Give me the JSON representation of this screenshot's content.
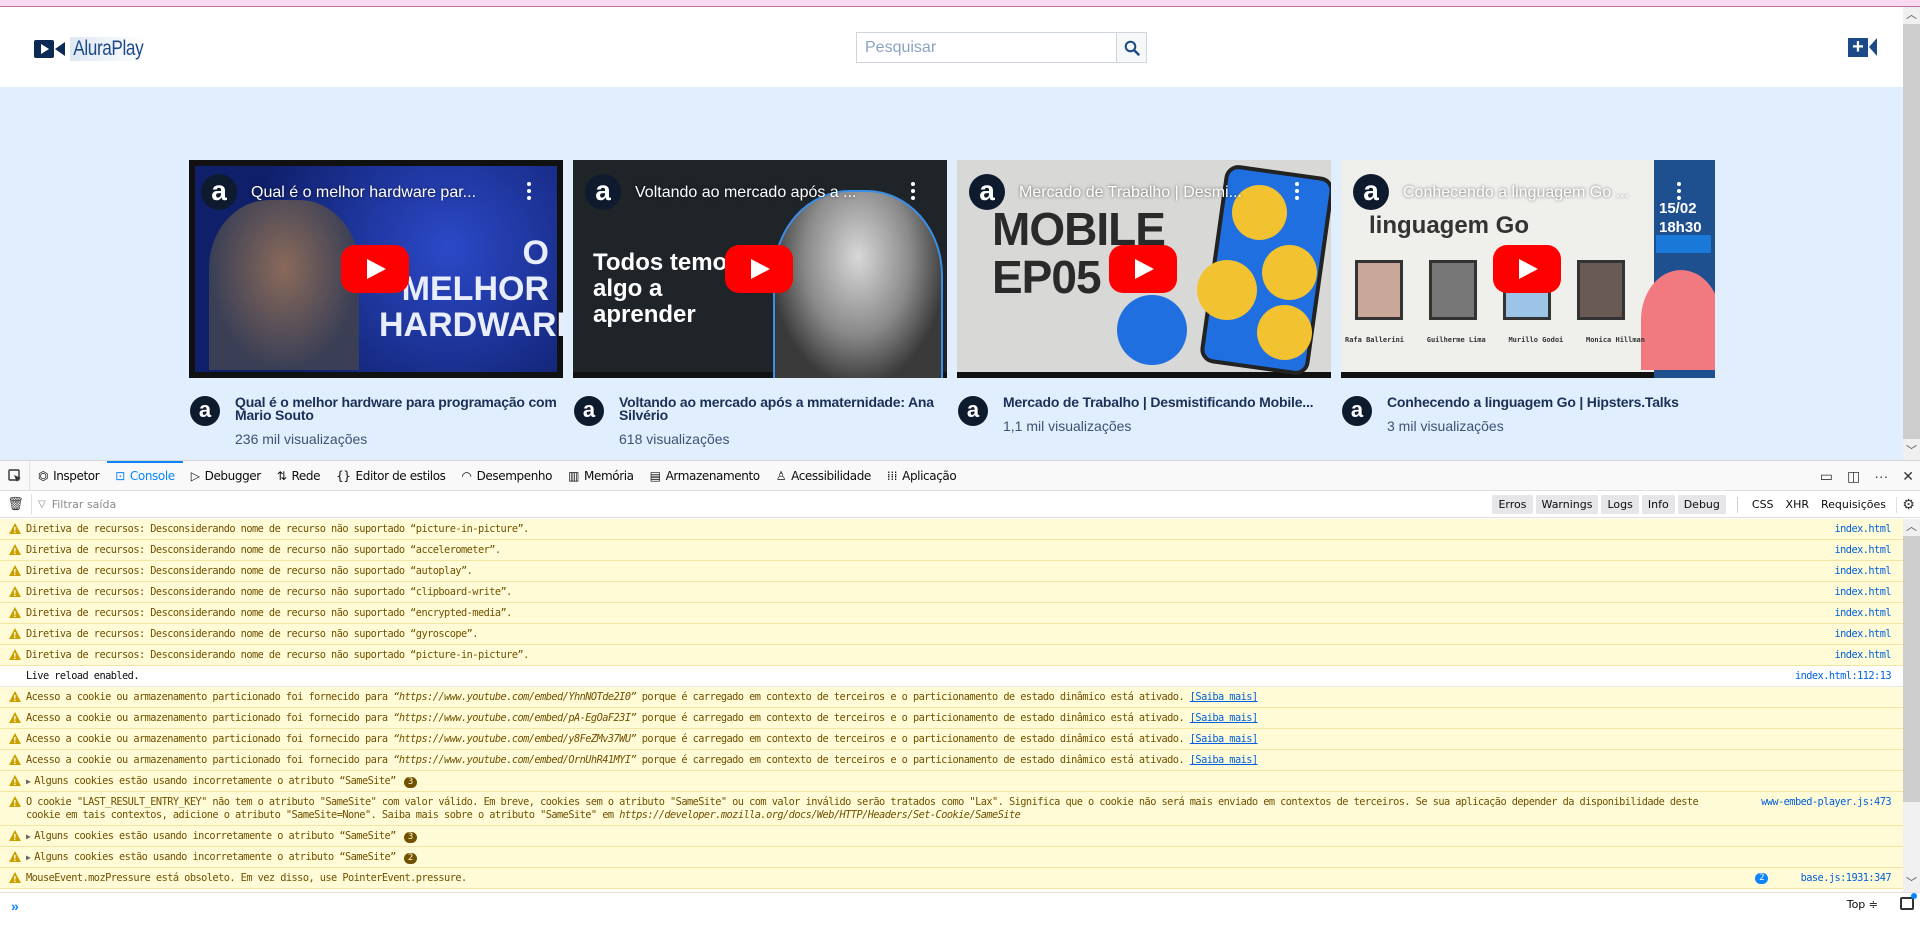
{
  "site": {
    "logo_text": "AluraPlay",
    "search_placeholder": "Pesquisar",
    "search_value": ""
  },
  "videos": [
    {
      "overlay_title": "Qual é o melhor hardware par...",
      "title": "Qual é o melhor hardware para programação com Mario Souto",
      "views": "236 mil visualizações",
      "thumb_text": "O MELHOR HARDWARE",
      "thumb_color": "#1a2f8a"
    },
    {
      "overlay_title": "Voltando ao mercado após a ...",
      "title": "Voltando ao mercado após a mmaternidade: Ana Silvério",
      "views": "618 visualizações",
      "thumb_text": "Todos temos algo a aprender",
      "thumb_color": "#1e2428"
    },
    {
      "overlay_title": "Mercado de Trabalho | Desmi...",
      "title": "Mercado de Trabalho | Desmistificando Mobile...",
      "views": "1,1 mil visualizações",
      "thumb_text": "MOBILE EP05",
      "thumb_color": "#d8d8d6"
    },
    {
      "overlay_title": "Conhecendo a linguagem Go ...",
      "title": "Conhecendo a linguagem Go | Hipsters.Talks",
      "views": "3 mil visualizações",
      "thumb_text": "linguagem Go",
      "thumb_date": "15/02",
      "thumb_time": "18h30",
      "thumb_people": [
        "Rafa Ballerini",
        "Guilherme Lima",
        "Murillo Godoi",
        "Monica Hillman"
      ],
      "thumb_color": "#efefec"
    }
  ],
  "devtools": {
    "tabs": [
      {
        "label": "Inspetor",
        "icon": "inspector-icon"
      },
      {
        "label": "Console",
        "icon": "console-icon",
        "active": true
      },
      {
        "label": "Debugger",
        "icon": "debugger-icon"
      },
      {
        "label": "Rede",
        "icon": "network-icon"
      },
      {
        "label": "Editor de estilos",
        "icon": "style-editor-icon"
      },
      {
        "label": "Desempenho",
        "icon": "performance-icon"
      },
      {
        "label": "Memória",
        "icon": "memory-icon"
      },
      {
        "label": "Armazenamento",
        "icon": "storage-icon"
      },
      {
        "label": "Acessibilidade",
        "icon": "accessibility-icon"
      },
      {
        "label": "Aplicação",
        "icon": "application-icon"
      }
    ],
    "filter_placeholder": "Filtrar saída",
    "filter_buttons": [
      "Erros",
      "Warnings",
      "Logs",
      "Info",
      "Debug"
    ],
    "filter_extra": [
      "CSS",
      "XHR",
      "Requisições"
    ],
    "messages": [
      {
        "type": "warn",
        "text": "Diretiva de recursos: Desconsiderando nome de recurso não suportado “picture-in-picture”.",
        "source": "index.html"
      },
      {
        "type": "warn",
        "text": "Diretiva de recursos: Desconsiderando nome de recurso não suportado “accelerometer”.",
        "source": "index.html"
      },
      {
        "type": "warn",
        "text": "Diretiva de recursos: Desconsiderando nome de recurso não suportado “autoplay”.",
        "source": "index.html"
      },
      {
        "type": "warn",
        "text": "Diretiva de recursos: Desconsiderando nome de recurso não suportado “clipboard-write”.",
        "source": "index.html"
      },
      {
        "type": "warn",
        "text": "Diretiva de recursos: Desconsiderando nome de recurso não suportado “encrypted-media”.",
        "source": "index.html"
      },
      {
        "type": "warn",
        "text": "Diretiva de recursos: Desconsiderando nome de recurso não suportado “gyroscope”.",
        "source": "index.html"
      },
      {
        "type": "warn",
        "text": "Diretiva de recursos: Desconsiderando nome de recurso não suportado “picture-in-picture”.",
        "source": "index.html"
      },
      {
        "type": "log",
        "text": "Live reload enabled.",
        "source": "index.html:112:13"
      },
      {
        "type": "warn",
        "pre": "Acesso a cookie ou armazenamento particionado foi fornecido para ",
        "url": "“https://www.youtube.com/embed/YhnNOTde2I0”",
        "post": " porque é carregado em contexto de terceiros e o particionamento de estado dinâmico está ativado. ",
        "link": "[Saiba mais]"
      },
      {
        "type": "warn",
        "pre": "Acesso a cookie ou armazenamento particionado foi fornecido para ",
        "url": "“https://www.youtube.com/embed/pA-EgOaF23I”",
        "post": " porque é carregado em contexto de terceiros e o particionamento de estado dinâmico está ativado. ",
        "link": "[Saiba mais]"
      },
      {
        "type": "warn",
        "pre": "Acesso a cookie ou armazenamento particionado foi fornecido para ",
        "url": "“https://www.youtube.com/embed/y8FeZMv37WU”",
        "post": " porque é carregado em contexto de terceiros e o particionamento de estado dinâmico está ativado. ",
        "link": "[Saiba mais]"
      },
      {
        "type": "warn",
        "pre": "Acesso a cookie ou armazenamento particionado foi fornecido para ",
        "url": "“https://www.youtube.com/embed/OrnUhR41MYI”",
        "post": " porque é carregado em contexto de terceiros e o particionamento de estado dinâmico está ativado. ",
        "link": "[Saiba mais]"
      },
      {
        "type": "warn",
        "group": true,
        "text": "Alguns cookies estão usando incorretamente o atributo “SameSite”",
        "count": "3"
      },
      {
        "type": "warn",
        "pre": "O cookie \"LAST_RESULT_ENTRY_KEY\" não tem o atributo \"SameSite\" com valor válido. Em breve, cookies sem o atributo \"SameSite\" ou com valor inválido serão tratados como \"Lax\". Significa que o cookie não será mais enviado em contextos de terceiros. Se sua aplicação depender da disponibilidade deste cookie em tais contextos, adicione o atributo \"SameSite=None\". Saiba mais sobre o atributo \"SameSite\" em ",
        "url": "https://developer.mozilla.org/docs/Web/HTTP/Headers/Set-Cookie/SameSite",
        "post": "",
        "source": "www-embed-player.js:473"
      },
      {
        "type": "warn",
        "group": true,
        "text": "Alguns cookies estão usando incorretamente o atributo “SameSite”",
        "count": "3"
      },
      {
        "type": "warn",
        "group": true,
        "text": "Alguns cookies estão usando incorretamente o atributo “SameSite”",
        "count": "2"
      },
      {
        "type": "warn",
        "text": "MouseEvent.mozPressure está obsoleto. Em vez disso, use PointerEvent.pressure.",
        "source": "base.js:1931:347",
        "repeat": "2"
      }
    ],
    "context_selector": "Top ≑"
  }
}
